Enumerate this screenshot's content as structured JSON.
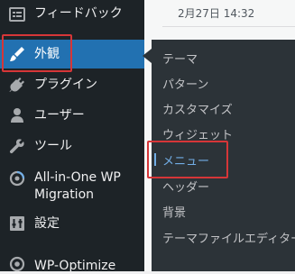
{
  "sidebar": {
    "items": [
      {
        "label": "フィードバック",
        "icon": "feedback-icon"
      },
      {
        "label": "外観",
        "icon": "appearance-brush-icon",
        "current": true
      },
      {
        "label": "プラグイン",
        "icon": "plugin-icon"
      },
      {
        "label": "ユーザー",
        "icon": "user-icon"
      },
      {
        "label": "ツール",
        "icon": "wrench-icon"
      },
      {
        "label": "All-in-One WP\nMigration",
        "line1": "All-in-One WP",
        "line2": "Migration",
        "icon": "migration-icon"
      },
      {
        "label": "設定",
        "icon": "settings-icon"
      },
      {
        "label": "WP-Optimize",
        "icon": "optimize-icon"
      }
    ]
  },
  "submenu": {
    "items": [
      {
        "label": "テーマ"
      },
      {
        "label": "パターン"
      },
      {
        "label": "カスタマイズ"
      },
      {
        "label": "ウィジェット"
      },
      {
        "label": "メニュー",
        "active": true
      },
      {
        "label": "ヘッダー"
      },
      {
        "label": "背景"
      },
      {
        "label": "テーマファイルエディター"
      }
    ]
  },
  "content": {
    "row_date": "2月27日 14:32"
  },
  "colors": {
    "sidebar_bg": "#1d2327",
    "flyout_bg": "#2c3338",
    "current_bg": "#2271b1",
    "highlight": "#d63638",
    "active_sub": "#72aee6"
  }
}
